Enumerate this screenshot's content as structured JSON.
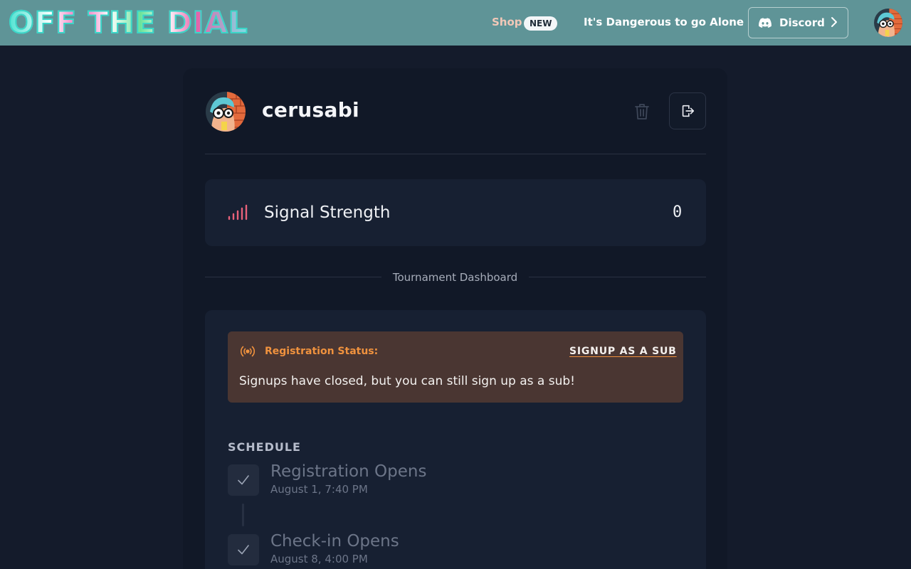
{
  "header": {
    "logo_text": "OFF THE DIAL",
    "nav": {
      "shop_label": "Shop",
      "shop_badge": "NEW",
      "dangerous_label": "It's Dangerous to go Alone",
      "discord_label": "Discord"
    }
  },
  "profile": {
    "username": "cerusabi"
  },
  "signal": {
    "label": "Signal Strength",
    "value": "0"
  },
  "dashboard": {
    "section_label": "Tournament Dashboard",
    "registration": {
      "title": "Registration Status:",
      "action_label": "SIGNUP AS A SUB",
      "message": "Signups have closed, but you can still sign up as a sub!"
    },
    "schedule": {
      "title": "SCHEDULE",
      "items": [
        {
          "title": "Registration Opens",
          "date": "August 1, 7:40 PM"
        },
        {
          "title": "Check-in Opens",
          "date": "August 8, 4:00 PM"
        }
      ]
    }
  },
  "colors": {
    "header_bg": "#5f9497",
    "page_bg": "#141b2b",
    "accent_orange": "#f0923e",
    "signal_pink": "#e8617a"
  },
  "icons": {
    "discord": "discord-icon",
    "trash": "trash-icon",
    "logout": "logout-icon",
    "signal": "signal-bars-icon",
    "broadcast": "broadcast-icon",
    "check": "check-icon",
    "chevron": "chevron-right-icon"
  }
}
